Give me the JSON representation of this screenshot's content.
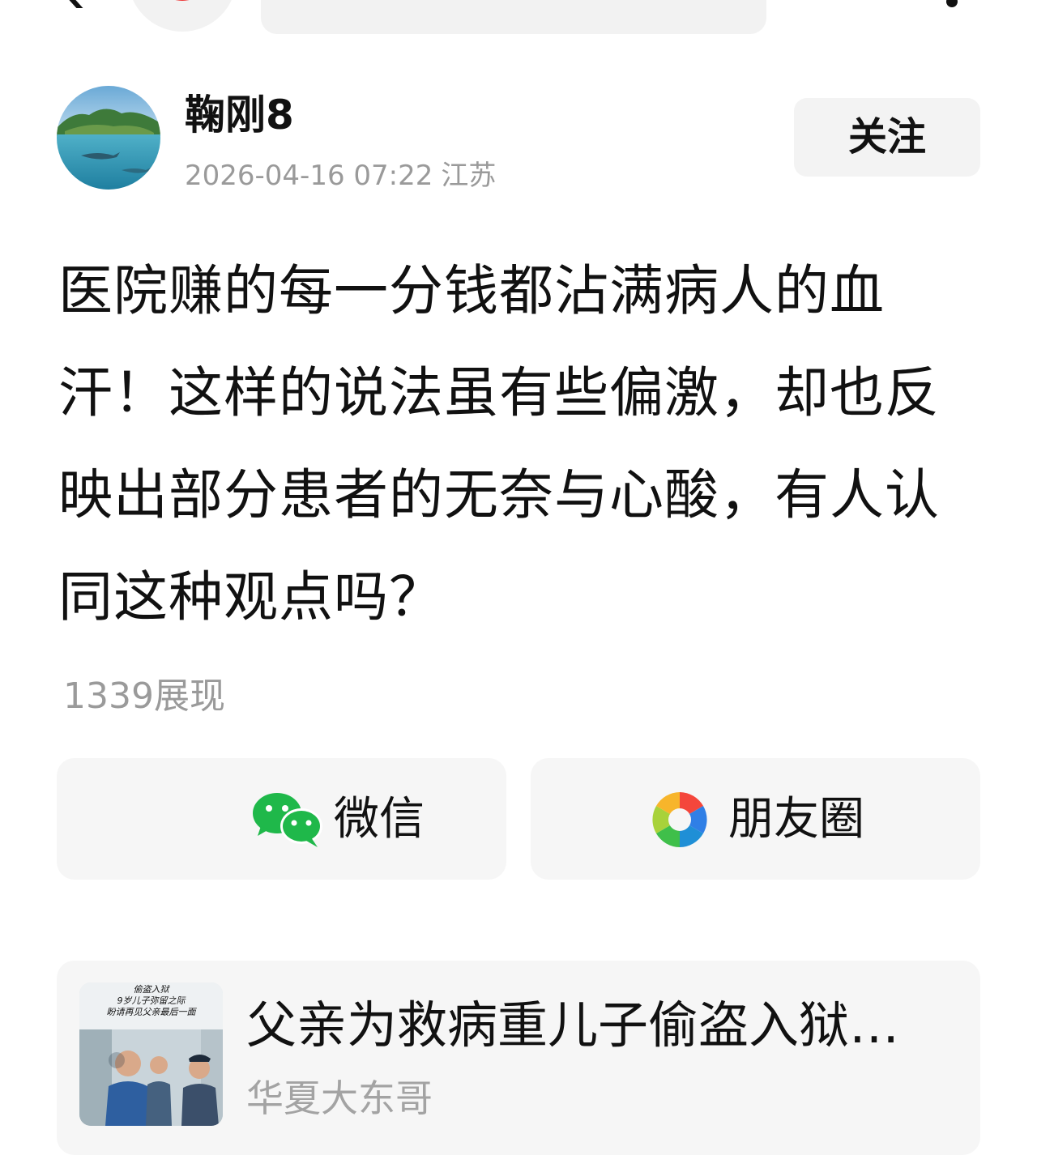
{
  "author": {
    "name": "鞠刚8",
    "date": "2026-04-16 07:22",
    "location": "江苏",
    "follow_label": "关注"
  },
  "post": {
    "text": "医院赚的每一分钱都沾满病人的血汗！这样的说法虽有些偏激，却也反映出部分患者的无奈与心酸，有人认同这种观点吗？",
    "views": "1339展现"
  },
  "share": {
    "wechat_label": "微信",
    "moments_label": "朋友圈",
    "wechat_color": "#1fb84a"
  },
  "related": {
    "title": "父亲为救病重儿子偷盗入狱…",
    "author": "华夏大东哥",
    "thumb_caption_1": "偷盗入狱",
    "thumb_caption_2": "9岁儿子弥留之际",
    "thumb_caption_3": "盼请再见父亲最后一面"
  },
  "icons": {
    "back": "back-arrow-icon",
    "search": "search-icon",
    "share": "share-icon",
    "more": "more-icon",
    "wechat": "wechat-icon",
    "moments": "moments-shutter-icon"
  }
}
